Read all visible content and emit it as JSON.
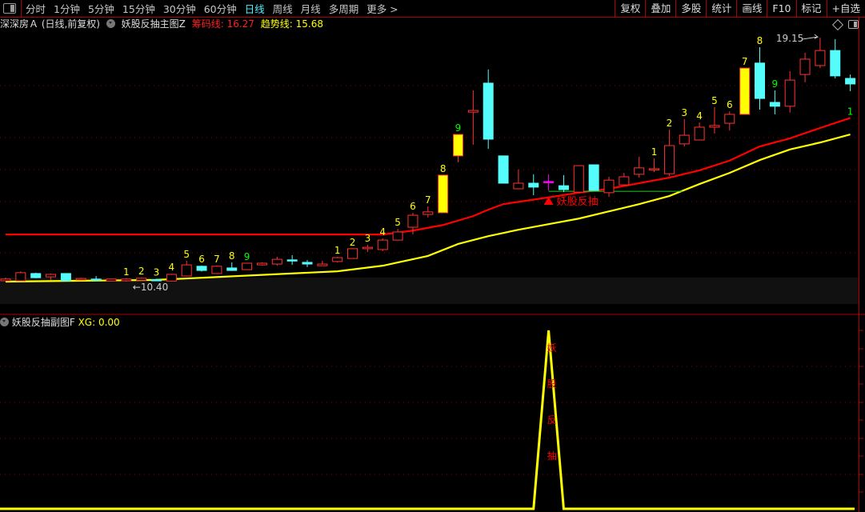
{
  "toolbar": {
    "periods": [
      "分时",
      "1分钟",
      "5分钟",
      "15分钟",
      "30分钟",
      "60分钟",
      "日线",
      "周线",
      "月线",
      "多周期",
      "更多 >"
    ],
    "active_period": "日线",
    "tools": [
      "复权",
      "叠加",
      "多股",
      "统计",
      "画线",
      "F10",
      "标记",
      "+自选"
    ]
  },
  "main_header": {
    "stock": "深深房Ａ (日线,前复权)",
    "indicator": "妖股反抽主图Z",
    "line1_label": "筹码线: 16.27",
    "line2_label": "趋势线: 15.68"
  },
  "sub_header": {
    "indicator": "妖股反抽副图F",
    "value_label": "XG: 0.00"
  },
  "colors": {
    "up": "#ff3232",
    "down": "#54fcfc",
    "highlight": "#ffff00",
    "chip_line": "#ff0000",
    "trend_line": "#ffff00",
    "signal": "#ff0000",
    "grid": "#8b0000",
    "doji_special": "#ff00ff"
  },
  "chart_data": [
    {
      "type": "candlestick",
      "price_range": [
        10.4,
        19.15
      ],
      "high_annotation": "19.15",
      "low_annotation": "10.40",
      "signal_text": "妖股反抽",
      "signal_index": 36,
      "support_level": 13.64,
      "candles": [
        [
          10.43,
          10.54,
          10.41,
          10.49
        ],
        [
          10.43,
          10.77,
          10.42,
          10.72
        ],
        [
          10.69,
          10.72,
          10.52,
          10.54
        ],
        [
          10.57,
          10.69,
          10.46,
          10.66
        ],
        [
          10.69,
          10.69,
          10.41,
          10.43
        ],
        [
          10.46,
          10.54,
          10.44,
          10.51
        ],
        [
          10.49,
          10.6,
          10.41,
          10.46
        ],
        [
          10.42,
          10.51,
          10.41,
          10.49
        ],
        [
          10.43,
          10.52,
          10.4,
          10.49
        ],
        [
          10.45,
          10.55,
          10.43,
          10.52
        ],
        [
          10.47,
          10.5,
          10.43,
          10.45
        ],
        [
          10.42,
          10.68,
          10.41,
          10.66
        ],
        [
          10.6,
          11.15,
          10.58,
          11.0
        ],
        [
          10.95,
          10.98,
          10.76,
          10.8
        ],
        [
          10.69,
          10.98,
          10.67,
          10.95
        ],
        [
          10.89,
          11.09,
          10.78,
          10.8
        ],
        [
          10.83,
          11.06,
          10.83,
          11.06
        ],
        [
          11.0,
          11.09,
          10.98,
          11.06
        ],
        [
          11.03,
          11.29,
          10.97,
          11.2
        ],
        [
          11.18,
          11.35,
          11.0,
          11.17
        ],
        [
          11.09,
          11.17,
          10.92,
          11.03
        ],
        [
          10.97,
          11.15,
          10.97,
          11.03
        ],
        [
          11.12,
          11.29,
          11.09,
          11.26
        ],
        [
          11.23,
          11.58,
          11.23,
          11.58
        ],
        [
          11.58,
          11.72,
          11.46,
          11.63
        ],
        [
          11.55,
          11.95,
          11.49,
          11.89
        ],
        [
          11.89,
          12.29,
          11.89,
          12.18
        ],
        [
          12.35,
          12.87,
          12.09,
          12.78
        ],
        [
          12.81,
          13.1,
          12.7,
          12.9
        ],
        [
          12.87,
          14.22,
          12.87,
          14.22
        ],
        [
          14.91,
          15.68,
          14.68,
          15.68
        ],
        [
          16.48,
          17.26,
          15.31,
          16.54
        ],
        [
          17.52,
          18.01,
          15.16,
          15.51
        ],
        [
          14.91,
          14.91,
          13.93,
          13.93
        ],
        [
          13.73,
          14.42,
          13.73,
          13.93
        ],
        [
          13.93,
          14.25,
          13.5,
          13.79
        ],
        [
          13.99,
          14.25,
          13.67,
          13.99
        ],
        [
          13.84,
          14.22,
          13.61,
          13.7
        ],
        [
          13.61,
          14.56,
          13.61,
          14.56
        ],
        [
          14.59,
          14.59,
          13.67,
          13.67
        ],
        [
          13.59,
          14.16,
          13.44,
          14.04
        ],
        [
          13.87,
          14.3,
          13.87,
          14.16
        ],
        [
          14.25,
          14.88,
          14.13,
          14.48
        ],
        [
          14.42,
          14.82,
          14.33,
          14.45
        ],
        [
          14.27,
          15.85,
          14.19,
          15.28
        ],
        [
          15.34,
          16.23,
          15.25,
          15.65
        ],
        [
          15.48,
          16.11,
          15.48,
          15.94
        ],
        [
          15.94,
          16.66,
          15.71,
          16.0
        ],
        [
          16.08,
          16.51,
          15.82,
          16.4
        ],
        [
          16.4,
          18.06,
          16.4,
          18.06
        ],
        [
          18.24,
          18.81,
          16.57,
          16.97
        ],
        [
          16.83,
          17.26,
          16.4,
          16.69
        ],
        [
          16.69,
          17.95,
          16.46,
          17.63
        ],
        [
          17.83,
          18.61,
          17.55,
          18.38
        ],
        [
          18.15,
          19.15,
          18.06,
          18.69
        ],
        [
          18.69,
          19.1,
          17.69,
          17.78
        ],
        [
          17.69,
          17.83,
          17.23,
          17.49
        ]
      ],
      "highlighted_candles": [
        29,
        30,
        49
      ],
      "special_candles": [
        36
      ],
      "count_labels": [
        {
          "i": 8,
          "t": "1",
          "c": "#ffff00"
        },
        {
          "i": 9,
          "t": "2",
          "c": "#ffff00"
        },
        {
          "i": 10,
          "t": "3",
          "c": "#ffff00"
        },
        {
          "i": 11,
          "t": "4",
          "c": "#ffff00"
        },
        {
          "i": 12,
          "t": "5",
          "c": "#ffff00"
        },
        {
          "i": 13,
          "t": "6",
          "c": "#ffff00"
        },
        {
          "i": 14,
          "t": "7",
          "c": "#ffff00"
        },
        {
          "i": 15,
          "t": "8",
          "c": "#ffff00"
        },
        {
          "i": 16,
          "t": "9",
          "c": "#00ff00"
        },
        {
          "i": 22,
          "t": "1",
          "c": "#ffff00"
        },
        {
          "i": 23,
          "t": "2",
          "c": "#ffff00"
        },
        {
          "i": 24,
          "t": "3",
          "c": "#ffff00"
        },
        {
          "i": 25,
          "t": "4",
          "c": "#ffff00"
        },
        {
          "i": 26,
          "t": "5",
          "c": "#ffff00"
        },
        {
          "i": 27,
          "t": "6",
          "c": "#ffff00"
        },
        {
          "i": 28,
          "t": "7",
          "c": "#ffff00"
        },
        {
          "i": 29,
          "t": "8",
          "c": "#ffff00"
        },
        {
          "i": 30,
          "t": "9",
          "c": "#00ff00"
        },
        {
          "i": 43,
          "t": "1",
          "c": "#ffff00"
        },
        {
          "i": 44,
          "t": "2",
          "c": "#ffff00"
        },
        {
          "i": 45,
          "t": "3",
          "c": "#ffff00"
        },
        {
          "i": 46,
          "t": "4",
          "c": "#ffff00"
        },
        {
          "i": 47,
          "t": "5",
          "c": "#ffff00"
        },
        {
          "i": 48,
          "t": "6",
          "c": "#ffff00"
        },
        {
          "i": 49,
          "t": "7",
          "c": "#ffff00"
        },
        {
          "i": 50,
          "t": "8",
          "c": "#ffff00"
        },
        {
          "i": 51,
          "t": "9",
          "c": "#00ff00"
        },
        {
          "i": 56,
          "t": "1",
          "c": "#00ff00",
          "below": true
        }
      ],
      "series": [
        {
          "name": "筹码线",
          "points": [
            [
              0,
              12.09
            ],
            [
              25,
              12.09
            ],
            [
              27,
              12.23
            ],
            [
              29,
              12.43
            ],
            [
              31,
              12.75
            ],
            [
              32,
              12.98
            ],
            [
              33,
              13.18
            ],
            [
              36,
              13.42
            ],
            [
              38,
              13.59
            ],
            [
              40,
              13.73
            ],
            [
              42,
              13.93
            ],
            [
              44,
              14.13
            ],
            [
              46,
              14.39
            ],
            [
              48,
              14.74
            ],
            [
              50,
              15.25
            ],
            [
              52,
              15.54
            ],
            [
              54,
              15.91
            ],
            [
              56,
              16.27
            ]
          ]
        },
        {
          "name": "趋势线",
          "points": [
            [
              0,
              10.4
            ],
            [
              10,
              10.46
            ],
            [
              22,
              10.77
            ],
            [
              25,
              10.97
            ],
            [
              28,
              11.32
            ],
            [
              30,
              11.75
            ],
            [
              32,
              12.03
            ],
            [
              34,
              12.26
            ],
            [
              36,
              12.46
            ],
            [
              38,
              12.66
            ],
            [
              40,
              12.92
            ],
            [
              42,
              13.18
            ],
            [
              44,
              13.47
            ],
            [
              46,
              13.9
            ],
            [
              48,
              14.3
            ],
            [
              50,
              14.76
            ],
            [
              52,
              15.14
            ],
            [
              54,
              15.39
            ],
            [
              56,
              15.68
            ]
          ]
        }
      ]
    },
    {
      "type": "line",
      "series": [
        {
          "name": "XG",
          "signal_index": 36,
          "peak": 1,
          "values_else": 0
        }
      ],
      "signal_text": [
        "妖",
        "股",
        "反",
        "抽"
      ]
    }
  ]
}
